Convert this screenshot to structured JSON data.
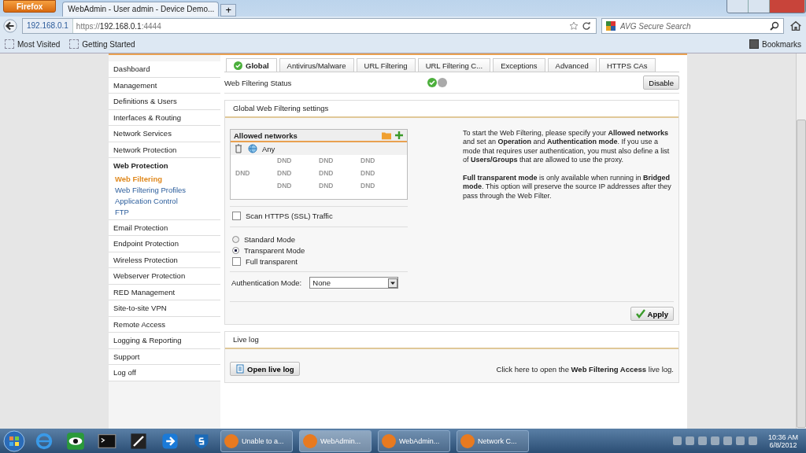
{
  "browser": {
    "menu_button": "Firefox",
    "tabs": [
      {
        "title": "WebAdmin - User admin - Device Demo...",
        "selected": true
      }
    ],
    "new_tab": "+",
    "site_badge": "192.168.0.1",
    "url": {
      "scheme": "https://",
      "host": "192.168.0.1",
      "port": ":4444"
    },
    "search_placeholder": "AVG Secure Search",
    "bookmarks": [
      "Most Visited",
      "Getting Started"
    ],
    "bookmarks_menu": "Bookmarks"
  },
  "sidebar": {
    "items": [
      {
        "label": "Dashboard",
        "expanded": false
      },
      {
        "label": "Management",
        "expanded": false
      },
      {
        "label": "Definitions & Users",
        "expanded": false
      },
      {
        "label": "Interfaces & Routing",
        "expanded": false
      },
      {
        "label": "Network Services",
        "expanded": false
      },
      {
        "label": "Network Protection",
        "expanded": false
      },
      {
        "label": "Web Protection",
        "expanded": true,
        "children": [
          {
            "label": "Web Filtering",
            "selected": true
          },
          {
            "label": "Web Filtering Profiles",
            "selected": false
          },
          {
            "label": "Application Control",
            "selected": false
          },
          {
            "label": "FTP",
            "selected": false
          }
        ]
      },
      {
        "label": "Email Protection",
        "expanded": false
      },
      {
        "label": "Endpoint Protection",
        "expanded": false
      },
      {
        "label": "Wireless Protection",
        "expanded": false
      },
      {
        "label": "Webserver Protection",
        "expanded": false
      },
      {
        "label": "RED Management",
        "expanded": false
      },
      {
        "label": "Site-to-site VPN",
        "expanded": false
      },
      {
        "label": "Remote Access",
        "expanded": false
      },
      {
        "label": "Logging & Reporting",
        "expanded": false
      },
      {
        "label": "Support",
        "expanded": false
      },
      {
        "label": "Log off",
        "expanded": false
      }
    ]
  },
  "tabs": [
    {
      "label": "Global",
      "selected": true
    },
    {
      "label": "Antivirus/Malware",
      "selected": false
    },
    {
      "label": "URL Filtering",
      "selected": false
    },
    {
      "label": "URL Filtering C...",
      "selected": false
    },
    {
      "label": "Exceptions",
      "selected": false
    },
    {
      "label": "Advanced",
      "selected": false
    },
    {
      "label": "HTTPS CAs",
      "selected": false
    }
  ],
  "status": {
    "label": "Web Filtering Status",
    "on": true,
    "button": "Disable"
  },
  "settings": {
    "title": "Global Web Filtering settings",
    "allowed_networks": {
      "title": "Allowed networks",
      "items": [
        "Any"
      ],
      "dnd_marks": [
        "DND",
        "DND",
        "DND",
        "DND",
        "DND",
        "DND",
        "DND",
        "DND",
        "DND",
        "DND"
      ]
    },
    "scan_https": {
      "label": "Scan HTTPS (SSL) Traffic",
      "checked": false
    },
    "modes": [
      {
        "label": "Standard Mode",
        "selected": false
      },
      {
        "label": "Transparent Mode",
        "selected": true
      }
    ],
    "full_transparent": {
      "label": "Full transparent",
      "checked": false
    },
    "auth": {
      "label": "Authentication Mode:",
      "value": "None"
    },
    "help": [
      "To start the Web Filtering, please specify your **Allowed networks** and set an **Operation** and **Authentication mode**. If you use a mode that requires user authentication, you must also define a list of **Users/Groups** that are allowed to use the proxy.",
      "**Full transparent mode** is only available when running in **Bridged mode**. This option will preserve the source IP addresses after they pass through the Web Filter."
    ],
    "apply": "Apply"
  },
  "live_log": {
    "title": "Live log",
    "button": "Open live log",
    "hint": "Click here to open the **Web Filtering Access** live log."
  },
  "taskbar": {
    "windows": [
      {
        "label": "Unable to a...",
        "selected": false
      },
      {
        "label": "WebAdmin...",
        "selected": true
      },
      {
        "label": "WebAdmin...",
        "selected": false
      },
      {
        "label": "Network C...",
        "selected": false
      }
    ],
    "time": "10:36 AM",
    "date": "6/8/2012"
  }
}
